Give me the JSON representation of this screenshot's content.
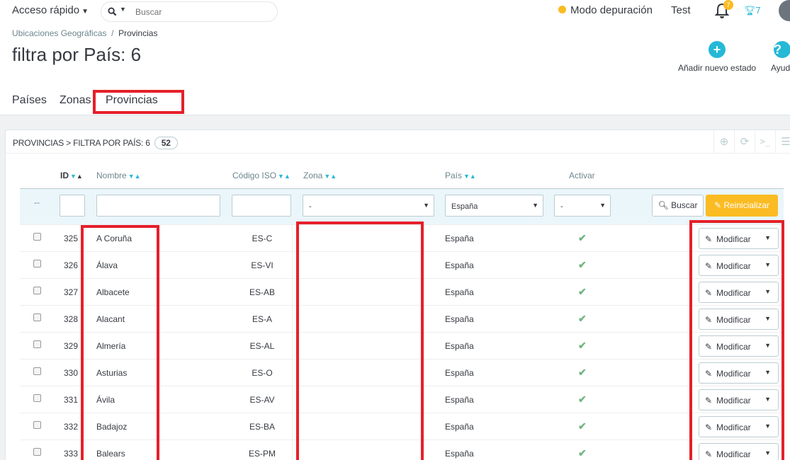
{
  "topbar": {
    "quick_access": "Acceso rápido",
    "search_placeholder": "Buscar",
    "debug_mode": "Modo depuración",
    "user": "Test",
    "notifications_count": "7",
    "trophy_count": "7"
  },
  "breadcrumb": {
    "parent": "Ubicaciones Geográficas",
    "separator": "/",
    "current": "Provincias"
  },
  "page_title": "filtra por País: 6",
  "toolbar": {
    "add_label": "Añadir nuevo estado",
    "help_label": "Ayuda"
  },
  "tabs": [
    "Países",
    "Zonas",
    "Provincias"
  ],
  "panel": {
    "title": "PROVINCIAS > FILTRA POR PAÍS: 6",
    "count": "52",
    "columns": {
      "id": "ID",
      "name": "Nombre",
      "iso": "Código ISO",
      "zone": "Zona",
      "country": "País",
      "active": "Activar"
    },
    "filters": {
      "dash": "--",
      "zone_value": "-",
      "country_value": "España",
      "active_value": "-",
      "search_label": "Buscar",
      "reset_label": "Reinicializar"
    },
    "rows": [
      {
        "id": "325",
        "name": "A Coruña",
        "iso": "ES-C",
        "country": "España"
      },
      {
        "id": "326",
        "name": "Álava",
        "iso": "ES-VI",
        "country": "España"
      },
      {
        "id": "327",
        "name": "Albacete",
        "iso": "ES-AB",
        "country": "España"
      },
      {
        "id": "328",
        "name": "Alacant",
        "iso": "ES-A",
        "country": "España"
      },
      {
        "id": "329",
        "name": "Almería",
        "iso": "ES-AL",
        "country": "España"
      },
      {
        "id": "330",
        "name": "Asturias",
        "iso": "ES-O",
        "country": "España"
      },
      {
        "id": "331",
        "name": "Ávila",
        "iso": "ES-AV",
        "country": "España"
      },
      {
        "id": "332",
        "name": "Badajoz",
        "iso": "ES-BA",
        "country": "España"
      },
      {
        "id": "333",
        "name": "Balears",
        "iso": "ES-PM",
        "country": "España"
      }
    ],
    "row_action": "Modificar"
  },
  "colors": {
    "accent": "#25b9d7",
    "warning": "#fbbb22",
    "highlight": "#e5202a",
    "success": "#70b580"
  }
}
